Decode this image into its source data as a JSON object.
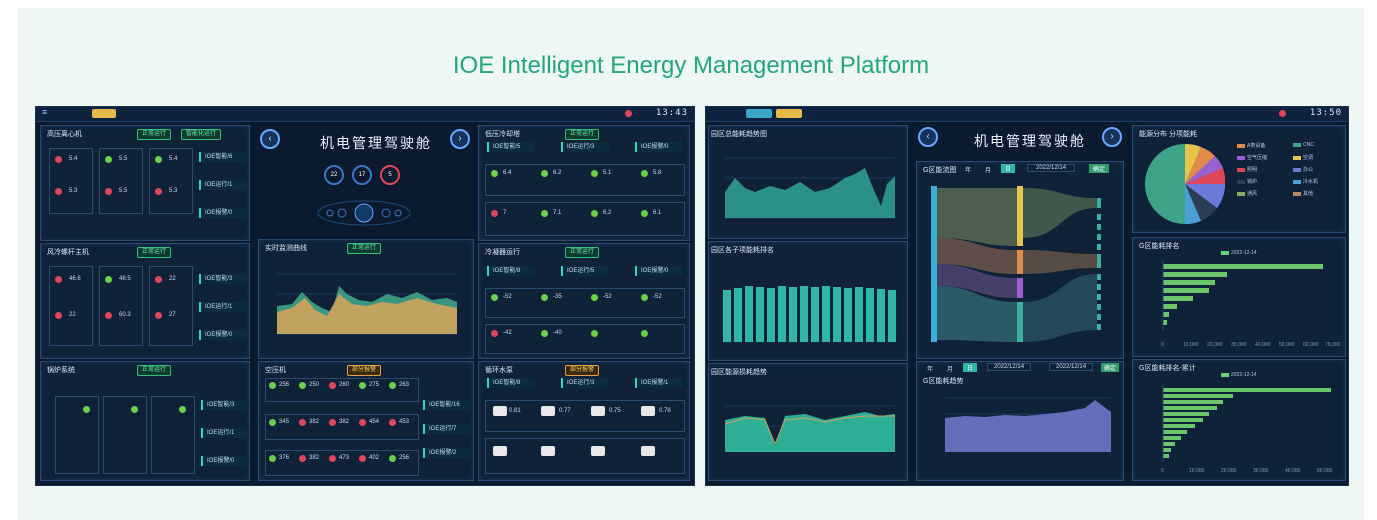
{
  "page_title": "IOE Intelligent Energy Management Platform",
  "left_screen": {
    "clock": "13:43",
    "header_title": "机电管理驾驶舱",
    "center_counts": [
      "22",
      "17",
      "5"
    ],
    "panels": {
      "p1": {
        "title": "高压离心机",
        "badges": [
          "正常运行",
          "智能化运行"
        ],
        "buttons": [
          "IOE智能/6",
          "IOE运行/1",
          "IOE报警/0"
        ],
        "values": [
          "5.4",
          "5.3",
          "5.5",
          "5.3",
          "5.4"
        ]
      },
      "p2": {
        "title": "风冷螺杆主机",
        "badges": [
          "正常运行"
        ],
        "buttons": [
          "IOE智能/3",
          "IOE运行/1",
          "IOE报警/0"
        ],
        "values": [
          "46.6",
          "48.5",
          "22",
          "22",
          "60.3",
          "27"
        ]
      },
      "p3": {
        "title": "低压冷却塔",
        "badges": [
          "正常运行"
        ],
        "buttons": [
          "IOE智能/5",
          "IOE运行/3",
          "IOE报警/0"
        ],
        "values": [
          "6.4",
          "6.2",
          "5.1",
          "5.8",
          "7",
          "7.1",
          "6.2",
          "6.1"
        ]
      },
      "p4": {
        "title": "冷凝器运行",
        "badges": [
          "正常运行"
        ],
        "buttons": [
          "IOE智能/8",
          "IOE运行/5",
          "IOE报警/0"
        ],
        "values": [
          "-52",
          "-35",
          "-52",
          "-52",
          "-42",
          "-40"
        ]
      },
      "p5": {
        "title": "实时监测曲线",
        "badges": [
          "正常运行"
        ]
      },
      "p6": {
        "title": "锅炉系统",
        "badges": [
          "正常运行"
        ],
        "buttons": [
          "IOE智能/3",
          "IOE运行/1",
          "IOE报警/0"
        ]
      },
      "p7": {
        "title": "空压机",
        "badges": [
          "部分报警"
        ],
        "buttons": [
          "IOE智能/16",
          "IOE运行/7",
          "IOE报警/2"
        ],
        "values": [
          "256",
          "250",
          "260",
          "275",
          "263",
          "256",
          "345",
          "382",
          "382",
          "454",
          "453",
          "376",
          "382",
          "473",
          "402",
          "256"
        ]
      },
      "p8": {
        "title": "循环水泵",
        "badges": [
          "部分报警"
        ],
        "buttons": [
          "IOE智能/8",
          "IOE运行/3",
          "IOE报警/1"
        ],
        "values": [
          "0.81",
          "0.77",
          "0.75",
          "0.78"
        ]
      }
    }
  },
  "right_screen": {
    "clock": "13:50",
    "header_title": "机电管理驾驶舱",
    "date_from": "2022/12/14",
    "date_to": "2022/12/14",
    "filter_tabs": [
      "年",
      "月",
      "日"
    ],
    "confirm": "确定",
    "panels": {
      "r1": {
        "title": "园区总能耗趋势图"
      },
      "r2": {
        "title": "园区各子项能耗排名"
      },
      "r3": {
        "title": "园区能源损耗趋势"
      },
      "r4": {
        "title": "G区能流图"
      },
      "r5": {
        "title": "G区能耗趋势"
      },
      "r6": {
        "title": "能源分布 分项能耗"
      },
      "r7": {
        "title": "G区能耗排名"
      },
      "r8": {
        "title": "G区能耗排名-累计"
      }
    },
    "pie_legend": [
      "A类设备",
      "CNC",
      "空气压缩",
      "空调",
      "照明",
      "办公",
      "锅炉",
      "冷水机",
      "通风",
      "其他"
    ],
    "axis_a": [
      "0",
      "10,000",
      "20,000",
      "30,000",
      "40,000",
      "50,000",
      "60,000",
      "70,000"
    ],
    "axis_b": [
      "0",
      "10,000",
      "20,000",
      "30,000",
      "40,000",
      "50,000"
    ],
    "legend_date": "2022-12-14"
  },
  "colors": {
    "title_green": "#23a67f",
    "bg_card": "#eef7f4",
    "dash_bg": "#0b1a2e"
  }
}
